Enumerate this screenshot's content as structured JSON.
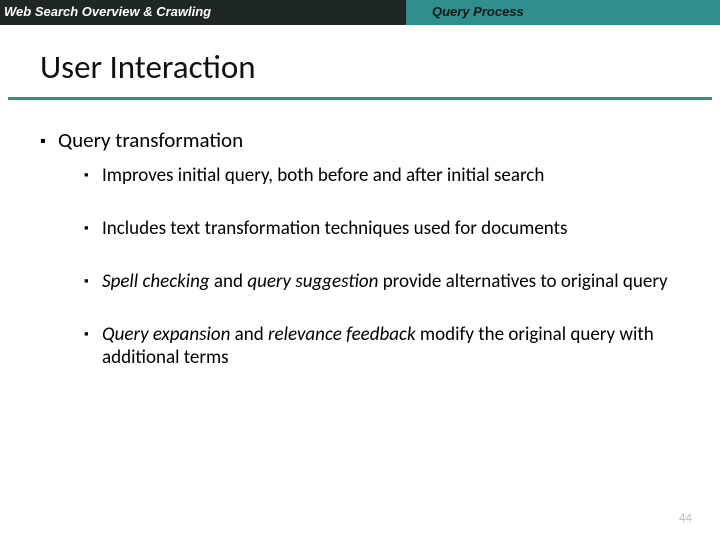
{
  "header": {
    "left": "Web Search Overview & Crawling",
    "right": "Query Process"
  },
  "title": "User Interaction",
  "bullets": {
    "main": "Query transformation",
    "subs": [
      {
        "plain": "Improves initial query, both before and after initial search"
      },
      {
        "plain": "Includes text transformation techniques used for documents"
      },
      {
        "em1": "Spell checking",
        "mid1": " and ",
        "em2": "query suggestion",
        "tail": " provide alternatives to original query"
      },
      {
        "em1": "Query expansion",
        "mid1": " and ",
        "em2": "relevance feedback",
        "tail": " modify the original query with additional terms"
      }
    ]
  },
  "page": "44"
}
